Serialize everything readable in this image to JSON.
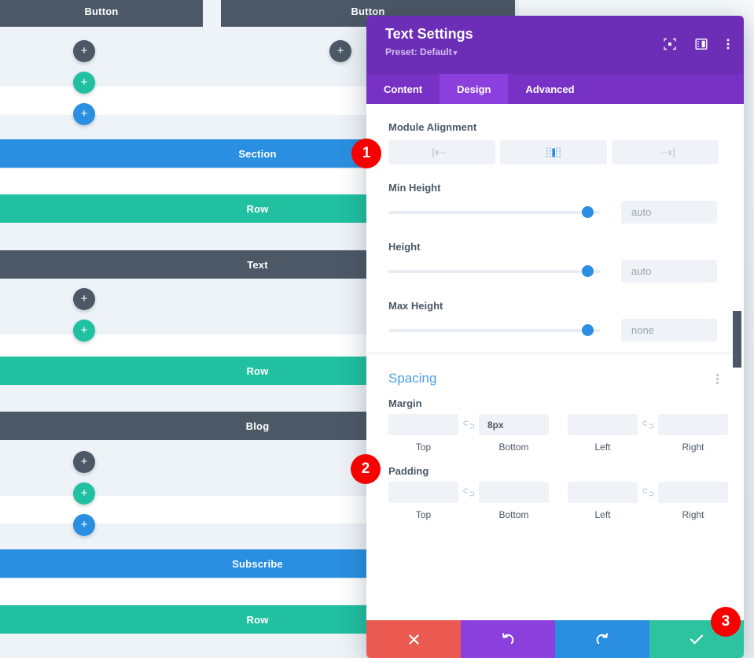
{
  "canvas": {
    "modules": [
      {
        "label": "Button",
        "type": "module"
      },
      {
        "label": "Button",
        "type": "module"
      },
      {
        "label": "Section",
        "type": "section"
      },
      {
        "label": "Row",
        "type": "row"
      },
      {
        "label": "Text",
        "type": "module"
      },
      {
        "label": "Row",
        "type": "row"
      },
      {
        "label": "Blog",
        "type": "module"
      },
      {
        "label": "Subscribe",
        "type": "section"
      },
      {
        "label": "Row",
        "type": "row"
      }
    ],
    "add_button_glyph": "+"
  },
  "modal": {
    "title": "Text Settings",
    "preset_label": "Preset: Default",
    "preset_caret": "▾",
    "head_icons": [
      "focus-icon",
      "responsive-view-icon",
      "more-options-icon"
    ],
    "tabs": [
      {
        "label": "Content",
        "active": false
      },
      {
        "label": "Design",
        "active": true
      },
      {
        "label": "Advanced",
        "active": false
      }
    ],
    "design": {
      "module_alignment": {
        "label": "Module Alignment",
        "options": [
          "align-left",
          "align-center",
          "align-right"
        ],
        "selected": "align-center"
      },
      "min_height": {
        "label": "Min Height",
        "value": "",
        "placeholder": "auto",
        "slider_pct": 94
      },
      "height": {
        "label": "Height",
        "value": "",
        "placeholder": "auto",
        "slider_pct": 94
      },
      "max_height": {
        "label": "Max Height",
        "value": "",
        "placeholder": "none",
        "slider_pct": 94
      },
      "spacing": {
        "title": "Spacing",
        "margin": {
          "label": "Margin",
          "fields": [
            {
              "caption": "Top",
              "value": ""
            },
            {
              "caption": "Bottom",
              "value": "8px"
            },
            {
              "caption": "Left",
              "value": ""
            },
            {
              "caption": "Right",
              "value": ""
            }
          ]
        },
        "padding": {
          "label": "Padding",
          "fields": [
            {
              "caption": "Top",
              "value": ""
            },
            {
              "caption": "Bottom",
              "value": ""
            },
            {
              "caption": "Left",
              "value": ""
            },
            {
              "caption": "Right",
              "value": ""
            }
          ]
        }
      }
    },
    "footer": [
      {
        "name": "cancel-button",
        "icon": "close-icon"
      },
      {
        "name": "undo-button",
        "icon": "undo-icon"
      },
      {
        "name": "redo-button",
        "icon": "redo-icon"
      },
      {
        "name": "save-button",
        "icon": "check-icon"
      }
    ]
  },
  "annotations": [
    {
      "number": "1"
    },
    {
      "number": "2"
    },
    {
      "number": "3"
    }
  ],
  "colors": {
    "purple": "#6d2eb7",
    "purple_tab": "#8b3fdd",
    "blue": "#2a8fe0",
    "green": "#21c0a0",
    "dark": "#4c5866",
    "red": "#eb5a50",
    "badge_red": "#f60000",
    "section_title": "#4b9fe5"
  }
}
